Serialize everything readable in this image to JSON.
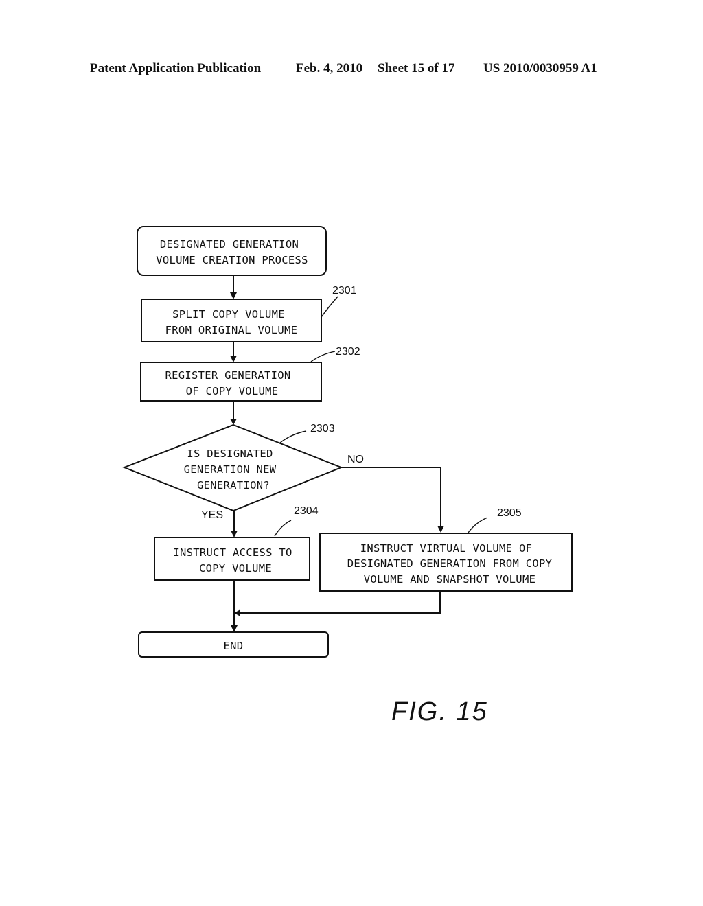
{
  "header": {
    "publication": "Patent Application Publication",
    "date": "Feb. 4, 2010",
    "sheet": "Sheet 15 of 17",
    "number": "US 2010/0030959 A1"
  },
  "flowchart": {
    "start": {
      "lines": [
        "DESIGNATED GENERATION",
        "VOLUME CREATION PROCESS"
      ]
    },
    "steps": [
      {
        "ref": "2301",
        "type": "process",
        "lines": [
          "SPLIT COPY VOLUME",
          "FROM ORIGINAL VOLUME"
        ]
      },
      {
        "ref": "2302",
        "type": "process",
        "lines": [
          "REGISTER GENERATION",
          "OF COPY VOLUME"
        ]
      },
      {
        "ref": "2303",
        "type": "decision",
        "lines": [
          "IS DESIGNATED",
          "GENERATION NEW",
          "GENERATION?"
        ]
      },
      {
        "ref": "2304",
        "type": "process",
        "lines": [
          "INSTRUCT ACCESS TO",
          "COPY VOLUME"
        ]
      },
      {
        "ref": "2305",
        "type": "process",
        "lines": [
          "INSTRUCT VIRTUAL VOLUME OF",
          "DESIGNATED GENERATION FROM COPY",
          "VOLUME AND SNAPSHOT VOLUME"
        ]
      }
    ],
    "branches": {
      "yes": "YES",
      "no": "NO"
    },
    "end": {
      "lines": [
        "END"
      ]
    }
  },
  "figure_label": "FIG. 15"
}
